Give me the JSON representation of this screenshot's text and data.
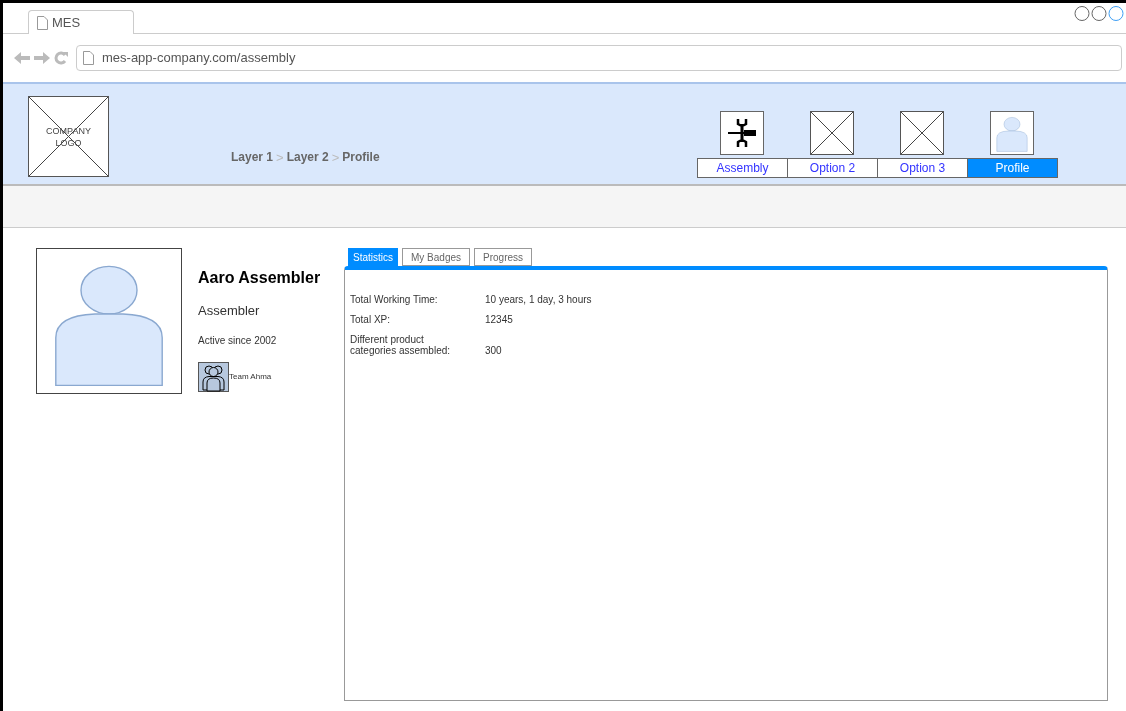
{
  "browser": {
    "tab_title": "MES",
    "url": "mes-app-company.com/assembly"
  },
  "header": {
    "logo_text": "COMPANY LOGO",
    "breadcrumb": [
      {
        "label": "Layer 1",
        "kind": "crumb"
      },
      {
        "label": ">",
        "kind": "separator"
      },
      {
        "label": "Layer 2",
        "kind": "crumb"
      },
      {
        "label": ">",
        "kind": "separator"
      },
      {
        "label": "Profile",
        "kind": "crumb"
      }
    ],
    "nav": [
      {
        "label": "Assembly",
        "kind": "tools",
        "selected": false
      },
      {
        "label": "Option 2",
        "kind": "placeholder",
        "selected": false
      },
      {
        "label": "Option 3",
        "kind": "placeholder",
        "selected": false
      },
      {
        "label": "Profile",
        "kind": "person",
        "selected": true
      }
    ]
  },
  "profile": {
    "name": "Aaro Assembler",
    "role": "Assembler",
    "active_since": "Active since 2002",
    "team": "Team Ahma"
  },
  "tabs": [
    {
      "label": "Statistics",
      "selected": true
    },
    {
      "label": "My Badges",
      "selected": false
    },
    {
      "label": "Progress",
      "selected": false
    }
  ],
  "stats": [
    {
      "label": "Total Working Time:",
      "value": "10 years, 1 day, 3 hours"
    },
    {
      "label": "Total XP:",
      "value": "12345"
    },
    {
      "label": "Different product categories assembled:",
      "value": "300"
    }
  ]
}
